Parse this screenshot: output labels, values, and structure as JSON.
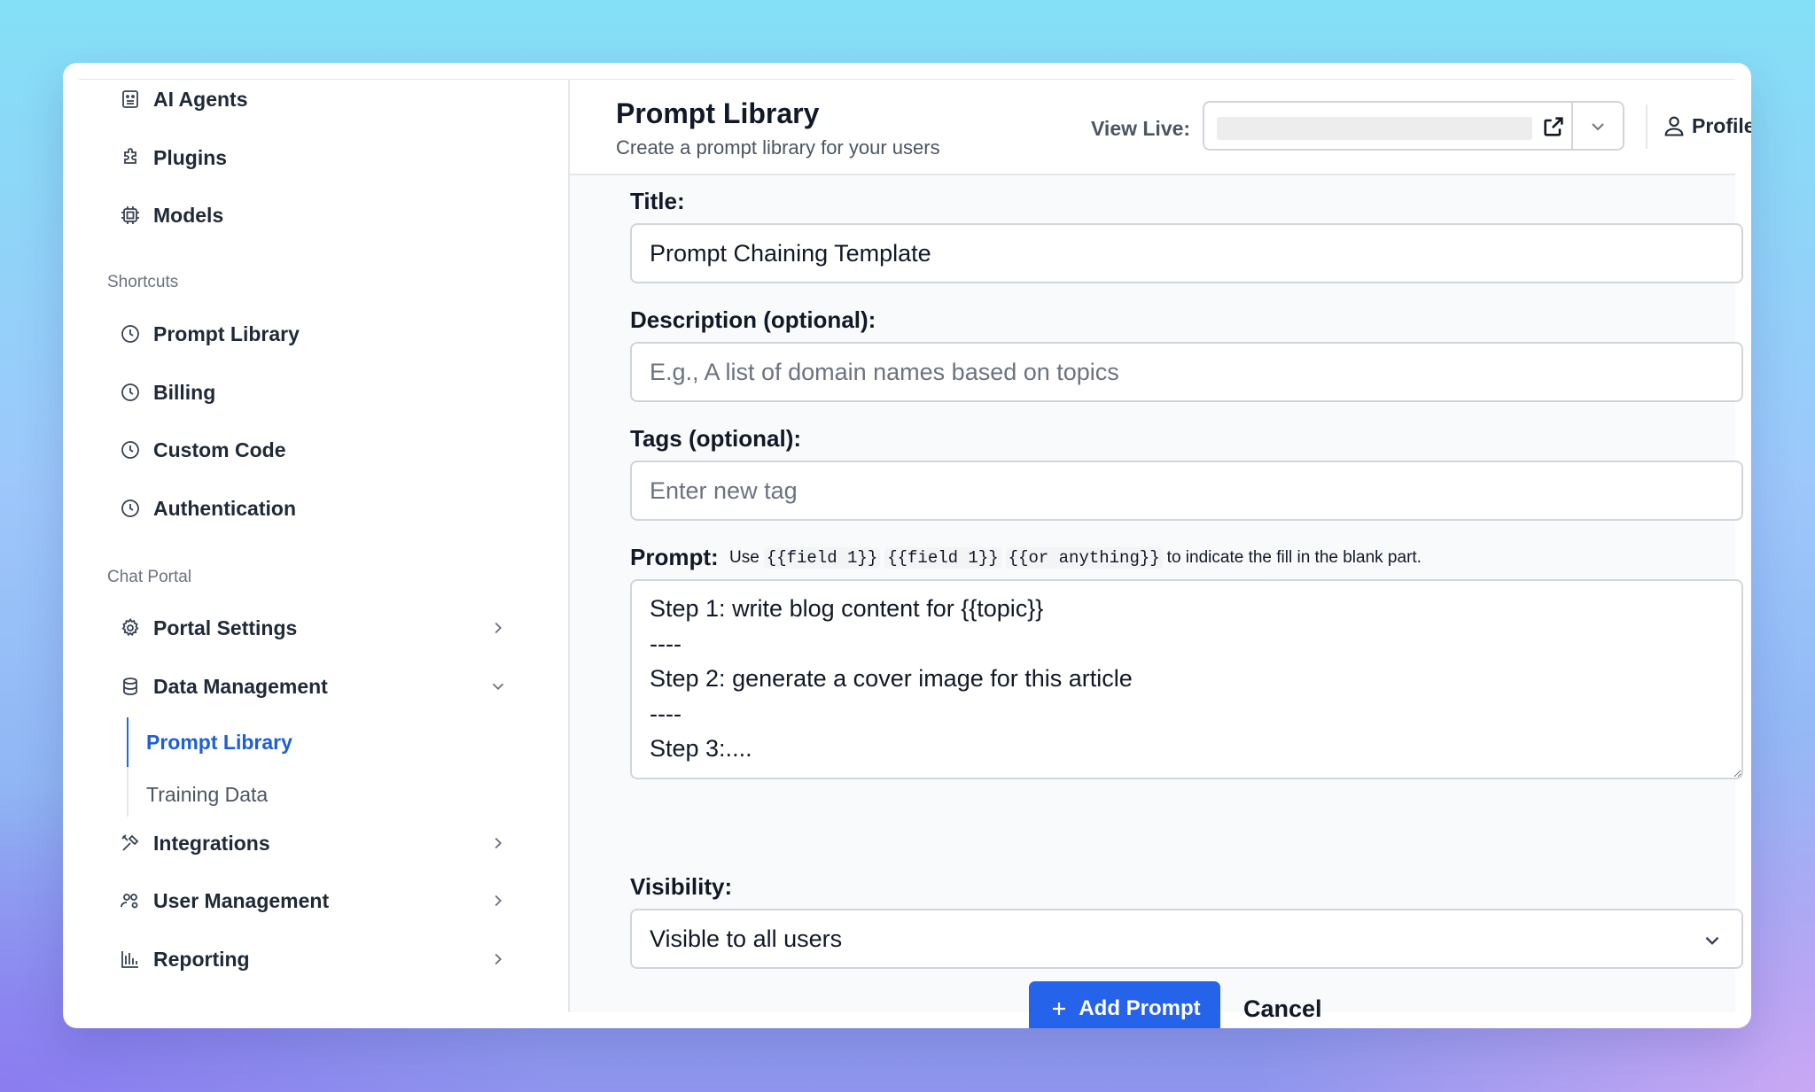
{
  "sidebar": {
    "items_top": [
      {
        "label": "AI Agents",
        "icon": "robot-icon"
      },
      {
        "label": "Plugins",
        "icon": "puzzle-icon"
      },
      {
        "label": "Models",
        "icon": "cpu-chip-icon"
      }
    ],
    "shortcuts_label": "Shortcuts",
    "shortcuts": [
      {
        "label": "Prompt Library",
        "icon": "clock-icon"
      },
      {
        "label": "Billing",
        "icon": "clock-icon"
      },
      {
        "label": "Custom Code",
        "icon": "clock-icon"
      },
      {
        "label": "Authentication",
        "icon": "clock-icon"
      }
    ],
    "chat_portal_label": "Chat Portal",
    "chat_portal": [
      {
        "label": "Portal Settings",
        "icon": "gear-icon",
        "state": "collapsed"
      },
      {
        "label": "Data Management",
        "icon": "database-icon",
        "state": "expanded"
      }
    ],
    "data_management_children": [
      {
        "label": "Prompt Library",
        "active": true
      },
      {
        "label": "Training Data",
        "active": false
      }
    ],
    "chat_portal_more": [
      {
        "label": "Integrations",
        "icon": "tools-icon"
      },
      {
        "label": "User Management",
        "icon": "users-gear-icon"
      },
      {
        "label": "Reporting",
        "icon": "bar-chart-icon"
      }
    ]
  },
  "header": {
    "title": "Prompt Library",
    "subtitle": "Create a prompt library for your users",
    "view_live_label": "View Live:",
    "profile_label": "Profile"
  },
  "form": {
    "title_label": "Title:",
    "title_value": "Prompt Chaining Template",
    "description_label": "Description (optional):",
    "description_placeholder": "E.g., A list of domain names based on topics",
    "tags_label": "Tags (optional):",
    "tags_placeholder": "Enter new tag",
    "prompt_label": "Prompt:",
    "prompt_hint_use": "Use",
    "prompt_hint_chips": [
      "{{field 1}}",
      "{{field 1}}",
      "{{or anything}}"
    ],
    "prompt_hint_rest": "to indicate the fill in the blank part.",
    "prompt_value": "Step 1: write blog content for {{topic}}\n----\nStep 2: generate a cover image for this article\n----\nStep 3:....",
    "visibility_label": "Visibility:",
    "visibility_value": "Visible to all users",
    "add_button": "Add Prompt",
    "cancel_button": "Cancel"
  },
  "colors": {
    "accent": "#2563eb",
    "active_nav": "#1d5fd6"
  }
}
